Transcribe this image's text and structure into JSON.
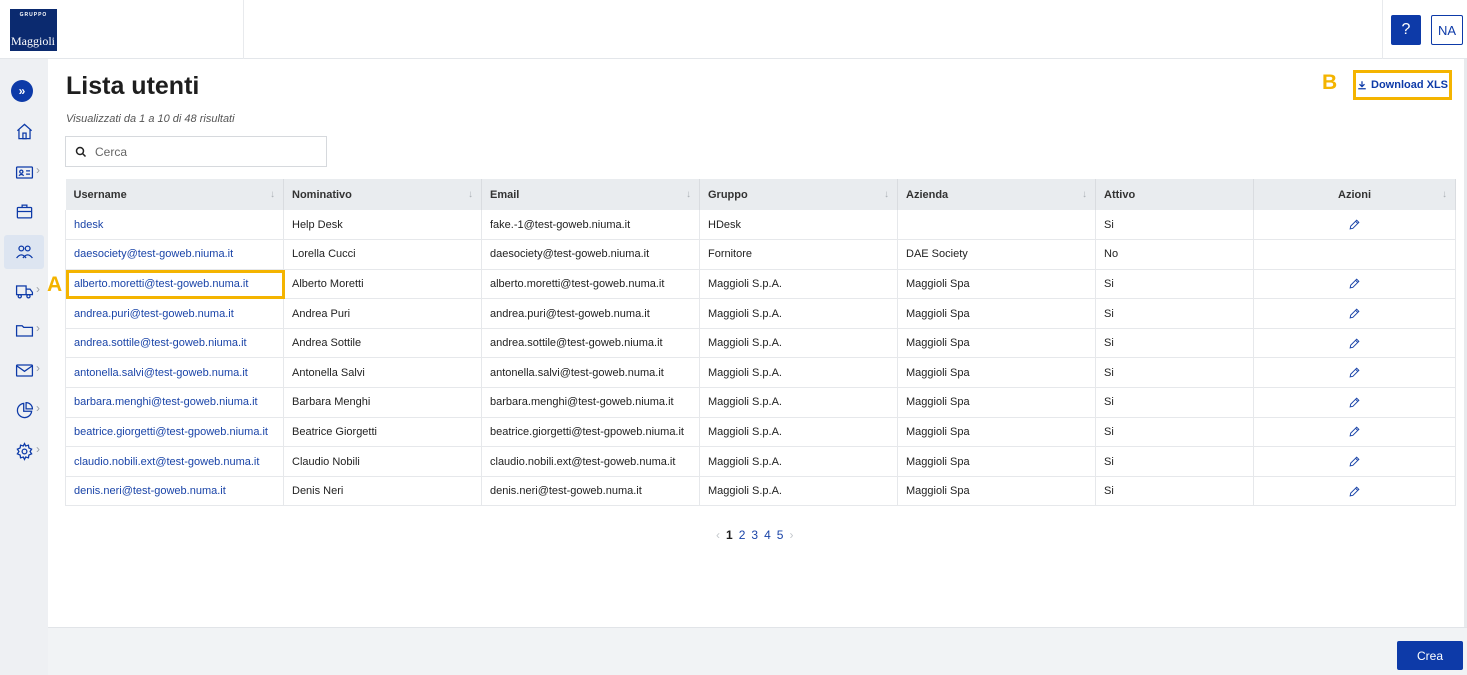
{
  "header": {
    "logo_small": "GRUPPO",
    "logo_big": "Maggioli",
    "help_label": "?",
    "user_initials": "NA"
  },
  "sidebar": {
    "items": [
      {
        "icon": "home-icon"
      },
      {
        "icon": "id-card-icon",
        "has_chevron": true
      },
      {
        "icon": "briefcase-icon"
      },
      {
        "icon": "users-icon",
        "active": true
      },
      {
        "icon": "truck-icon",
        "has_chevron": true
      },
      {
        "icon": "folder-icon",
        "has_chevron": true
      },
      {
        "icon": "mail-icon",
        "has_chevron": true
      },
      {
        "icon": "pie-chart-icon",
        "has_chevron": true
      },
      {
        "icon": "gear-icon",
        "has_chevron": true
      }
    ],
    "chevron": "›"
  },
  "main": {
    "title": "Lista utenti",
    "results_info": "Visualizzati da 1 a 10 di 48 risultati",
    "search_placeholder": "Cerca",
    "download_label": "Download XLS",
    "annotation_a": "A",
    "annotation_b": "B"
  },
  "table": {
    "columns": [
      "Username",
      "Nominativo",
      "Email",
      "Gruppo",
      "Azienda",
      "Attivo",
      "Azioni"
    ],
    "rows": [
      {
        "username": "hdesk",
        "nominativo": "Help Desk",
        "email": "fake.-1@test-goweb.niuma.it",
        "gruppo": "HDesk",
        "azienda": "",
        "attivo": "Si",
        "edit": true
      },
      {
        "username": "daesociety@test-goweb.niuma.it",
        "nominativo": "Lorella Cucci",
        "email": "daesociety@test-goweb.niuma.it",
        "gruppo": "Fornitore",
        "azienda": "DAE Society",
        "attivo": "No",
        "edit": false
      },
      {
        "username": "alberto.moretti@test-goweb.numa.it",
        "nominativo": "Alberto Moretti",
        "email": "alberto.moretti@test-goweb.numa.it",
        "gruppo": "Maggioli S.p.A.",
        "azienda": "Maggioli Spa",
        "attivo": "Si",
        "edit": true
      },
      {
        "username": "andrea.puri@test-goweb.numa.it",
        "nominativo": "Andrea Puri",
        "email": "andrea.puri@test-goweb.numa.it",
        "gruppo": "Maggioli S.p.A.",
        "azienda": "Maggioli Spa",
        "attivo": "Si",
        "edit": true
      },
      {
        "username": "andrea.sottile@test-goweb.niuma.it",
        "nominativo": "Andrea Sottile",
        "email": "andrea.sottile@test-goweb.niuma.it",
        "gruppo": "Maggioli S.p.A.",
        "azienda": "Maggioli Spa",
        "attivo": "Si",
        "edit": true
      },
      {
        "username": "antonella.salvi@test-goweb.numa.it",
        "nominativo": "Antonella Salvi",
        "email": "antonella.salvi@test-goweb.numa.it",
        "gruppo": "Maggioli S.p.A.",
        "azienda": "Maggioli Spa",
        "attivo": "Si",
        "edit": true
      },
      {
        "username": "barbara.menghi@test-goweb.niuma.it",
        "nominativo": "Barbara Menghi",
        "email": "barbara.menghi@test-goweb.niuma.it",
        "gruppo": "Maggioli S.p.A.",
        "azienda": "Maggioli Spa",
        "attivo": "Si",
        "edit": true
      },
      {
        "username": "beatrice.giorgetti@test-gpoweb.niuma.it",
        "nominativo": "Beatrice Giorgetti",
        "email": "beatrice.giorgetti@test-gpoweb.niuma.it",
        "gruppo": "Maggioli S.p.A.",
        "azienda": "Maggioli Spa",
        "attivo": "Si",
        "edit": true
      },
      {
        "username": "claudio.nobili.ext@test-goweb.numa.it",
        "nominativo": "Claudio Nobili",
        "email": "claudio.nobili.ext@test-goweb.numa.it",
        "gruppo": "Maggioli S.p.A.",
        "azienda": "Maggioli Spa",
        "attivo": "Si",
        "edit": true
      },
      {
        "username": "denis.neri@test-goweb.numa.it",
        "nominativo": "Denis Neri",
        "email": "denis.neri@test-goweb.numa.it",
        "gruppo": "Maggioli S.p.A.",
        "azienda": "Maggioli Spa",
        "attivo": "Si",
        "edit": true
      }
    ]
  },
  "pagination": {
    "prev": "‹",
    "next": "›",
    "pages": [
      "1",
      "2",
      "3",
      "4",
      "5"
    ],
    "current": "1"
  },
  "footer": {
    "create_label": "Crea"
  },
  "colors": {
    "primary": "#0d3aa8",
    "highlight": "#f4b400",
    "link": "#1a44a8"
  }
}
